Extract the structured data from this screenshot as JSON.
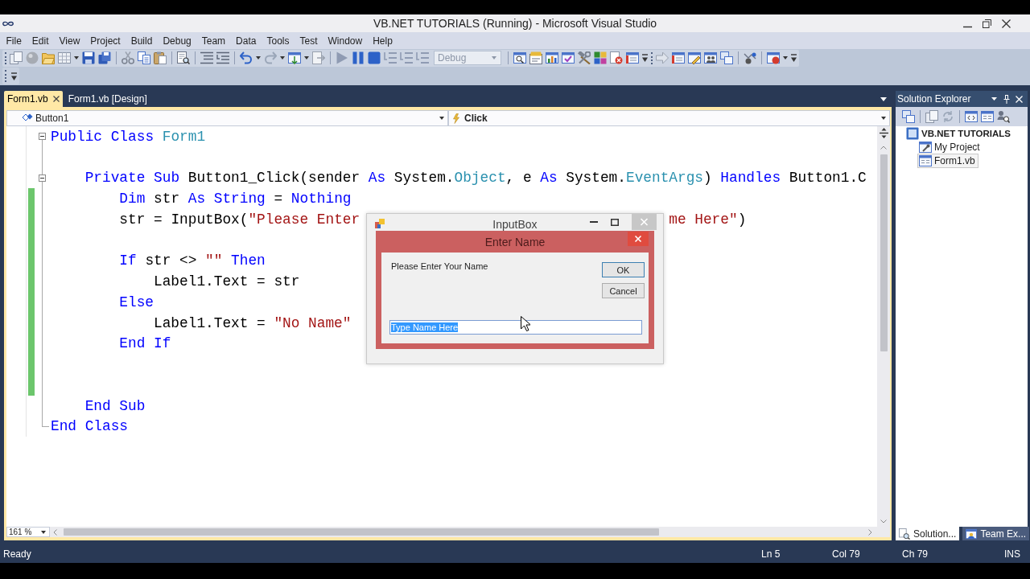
{
  "window": {
    "title": "VB.NET TUTORIALS (Running) - Microsoft Visual Studio"
  },
  "menu": [
    "File",
    "Edit",
    "View",
    "Project",
    "Build",
    "Debug",
    "Team",
    "Data",
    "Tools",
    "Test",
    "Window",
    "Help"
  ],
  "toolbar": {
    "configuration": {
      "value": "Debug",
      "disabled": true
    }
  },
  "document_tabs": [
    {
      "label": "Form1.vb",
      "selected": true
    },
    {
      "label": "Form1.vb [Design]",
      "selected": false
    }
  ],
  "navigation_bar": {
    "object": "Button1",
    "member": "Click"
  },
  "editor": {
    "zoom": "161 %",
    "lines": [
      {
        "fold": true,
        "changed": false,
        "parts": [
          [
            {
              "kind": "keyword",
              "text": "Public Class "
            },
            {
              "kind": "type",
              "text": "Form1"
            }
          ]
        ],
        "children": [
          {
            "fold": false,
            "changed": false
          },
          {
            "fold": true,
            "changed": false,
            "parts": [
              [
                {
                  "kind": "keyword",
                  "text": "Private Sub "
                },
                {
                  "kind": "plain",
                  "text": "Button1_Click(sender "
                },
                {
                  "kind": "keyword",
                  "text": "As "
                },
                {
                  "kind": "plain",
                  "text": "System."
                },
                {
                  "kind": "type",
                  "text": "Object"
                },
                {
                  "kind": "plain",
                  "text": ", e "
                },
                {
                  "kind": "keyword",
                  "text": "As "
                },
                {
                  "kind": "plain",
                  "text": "System."
                },
                {
                  "kind": "type",
                  "text": "EventArgs"
                },
                {
                  "kind": "plain",
                  "text": ") "
                },
                {
                  "kind": "keyword",
                  "text": "Handles "
                },
                {
                  "kind": "plain",
                  "text": "Button1.C"
                }
              ]
            ],
            "children": [
              {
                "fold": false,
                "changed": true,
                "parts": [
                  [
                    {
                      "kind": "keyword",
                      "text": "Dim "
                    },
                    {
                      "kind": "plain",
                      "text": "str "
                    },
                    {
                      "kind": "keyword",
                      "text": "As String "
                    },
                    {
                      "kind": "plain",
                      "text": "= "
                    },
                    {
                      "kind": "keyword",
                      "text": "Nothing"
                    }
                  ]
                ]
              },
              {
                "fold": false,
                "changed": true,
                "parts": [
                  [
                    {
                      "kind": "plain",
                      "text": "str = InputBox("
                    },
                    {
                      "kind": "string",
                      "text": "\"Please Enter"
                    }
                  ],
                  [
                    {
                      "kind": "string",
                      "text": "me Here\""
                    },
                    {
                      "kind": "plain",
                      "text": ")"
                    }
                  ]
                ]
              },
              {
                "fold": false,
                "changed": true
              },
              {
                "fold": false,
                "changed": true,
                "parts": [
                  [
                    {
                      "kind": "keyword",
                      "text": "If "
                    },
                    {
                      "kind": "plain",
                      "text": "str <> "
                    },
                    {
                      "kind": "string",
                      "text": "\"\""
                    },
                    {
                      "kind": "keyword",
                      "text": " Then"
                    }
                  ]
                ],
                "children": [
                  {
                    "fold": false,
                    "changed": true,
                    "parts": [
                      [
                        {
                          "kind": "plain",
                          "text": "Label1.Text = str"
                        }
                      ]
                    ]
                  }
                ]
              },
              {
                "fold": false,
                "changed": true,
                "parts": [
                  [
                    {
                      "kind": "keyword",
                      "text": "Else"
                    }
                  ]
                ],
                "children": [
                  {
                    "fold": false,
                    "changed": true,
                    "parts": [
                      [
                        {
                          "kind": "plain",
                          "text": "Label1.Text = "
                        },
                        {
                          "kind": "string",
                          "text": "\"No Name\""
                        }
                      ]
                    ]
                  }
                ]
              },
              {
                "fold": false,
                "changed": true,
                "parts": [
                  [
                    {
                      "kind": "keyword",
                      "text": "End If"
                    }
                  ]
                ]
              },
              {
                "fold": false,
                "changed": true
              },
              {
                "fold": false,
                "changed": true
              }
            ]
          },
          {
            "fold": false,
            "changed": false,
            "parts": [
              [
                {
                  "kind": "keyword",
                  "text": "End Sub"
                }
              ]
            ]
          }
        ]
      },
      {
        "fold": false,
        "changed": false,
        "parts": [
          [
            {
              "kind": "keyword",
              "text": "End Class"
            }
          ]
        ]
      }
    ]
  },
  "input_box": {
    "window_title": "InputBox",
    "title": "Enter Name",
    "prompt": "Please Enter Your Name",
    "buttons": [
      {
        "label": "OK",
        "default": true
      },
      {
        "label": "Cancel",
        "default": false
      }
    ],
    "value": "Type Name Here",
    "value_selected": true
  },
  "solution_explorer": {
    "title": "Solution Explorer",
    "tree": [
      {
        "label": "VB.NET TUTORIALS",
        "kind": "solution",
        "selected": false,
        "children": [
          {
            "label": "My Project",
            "kind": "properties",
            "selected": false
          },
          {
            "label": "Form1.vb",
            "kind": "form",
            "selected": true
          }
        ]
      }
    ],
    "tabs": [
      {
        "label": "Solution...",
        "selected": true
      },
      {
        "label": "Team Ex...",
        "selected": false
      }
    ]
  },
  "status_bar": {
    "message": "Ready",
    "line": "Ln 5",
    "column": "Col 79",
    "character": "Ch 79",
    "mode": "INS"
  }
}
